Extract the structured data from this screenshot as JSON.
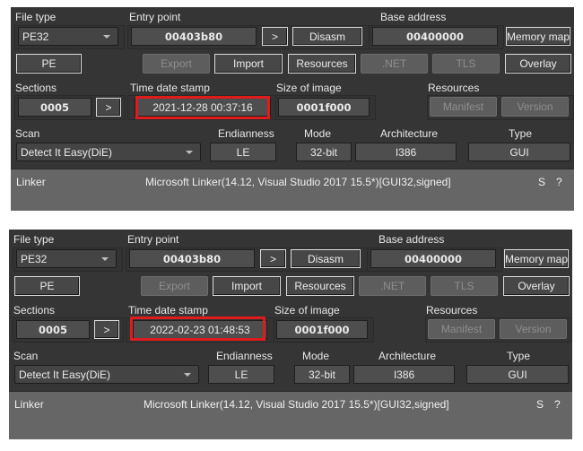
{
  "labels": {
    "file_type": "File type",
    "entry_point": "Entry point",
    "base_address": "Base address",
    "sections": "Sections",
    "time_date_stamp": "Time date stamp",
    "size_of_image": "Size of image",
    "resources": "Resources",
    "scan": "Scan",
    "endianness": "Endianness",
    "mode": "Mode",
    "architecture": "Architecture",
    "type": "Type"
  },
  "buttons": {
    "go": ">",
    "disasm": "Disasm",
    "memory_map": "Memory map",
    "pe": "PE",
    "export": "Export",
    "import": "Import",
    "resources": "Resources",
    "net": ".NET",
    "tls": "TLS",
    "overlay": "Overlay",
    "manifest": "Manifest",
    "version": "Version"
  },
  "highlight_color": "#e01b1b",
  "panels": [
    {
      "file_type": "PE32",
      "entry_point": "00403b80",
      "base_address": "00400000",
      "sections": "0005",
      "time_date_stamp": "2021-12-28 00:37:16",
      "size_of_image": "0001f000",
      "scan": "Detect It Easy(DiE)",
      "endianness": "LE",
      "mode": "32-bit",
      "architecture": "I386",
      "type": "GUI",
      "result": {
        "type": "Linker",
        "name": "Microsoft Linker(14.12, Visual Studio 2017 15.5*)[GUI32,signed]",
        "s": "S",
        "q": "?"
      }
    },
    {
      "file_type": "PE32",
      "entry_point": "00403b80",
      "base_address": "00400000",
      "sections": "0005",
      "time_date_stamp": "2022-02-23 01:48:53",
      "size_of_image": "0001f000",
      "scan": "Detect It Easy(DiE)",
      "endianness": "LE",
      "mode": "32-bit",
      "architecture": "I386",
      "type": "GUI",
      "result": {
        "type": "Linker",
        "name": "Microsoft Linker(14.12, Visual Studio 2017 15.5*)[GUI32,signed]",
        "s": "S",
        "q": "?"
      }
    }
  ]
}
